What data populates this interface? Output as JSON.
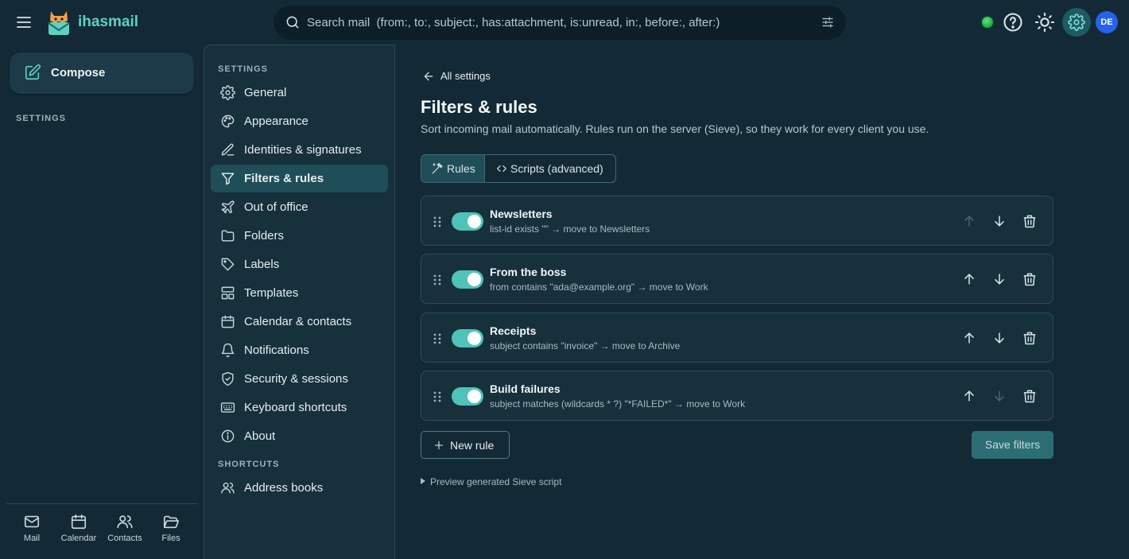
{
  "app": {
    "brand": "ihasmail",
    "search_placeholder": "Search mail  (from:, to:, subject:, has:attachment, is:unread, in:, before:, after:)",
    "avatar_initials": "DE",
    "accent_color": "#4fc3b8"
  },
  "rail": {
    "compose_label": "Compose",
    "section_heading": "SETTINGS",
    "bottom_nav": [
      {
        "label": "Mail",
        "icon": "mail-icon"
      },
      {
        "label": "Calendar",
        "icon": "calendar-icon"
      },
      {
        "label": "Contacts",
        "icon": "contacts-icon"
      },
      {
        "label": "Files",
        "icon": "folder-open-icon"
      }
    ]
  },
  "settings_nav": {
    "heading": "SETTINGS",
    "items": [
      {
        "label": "General",
        "icon": "gear-icon"
      },
      {
        "label": "Appearance",
        "icon": "palette-icon"
      },
      {
        "label": "Identities & signatures",
        "icon": "pen-icon"
      },
      {
        "label": "Filters & rules",
        "icon": "funnel-icon",
        "active": true
      },
      {
        "label": "Out of office",
        "icon": "plane-icon"
      },
      {
        "label": "Folders",
        "icon": "folder-icon"
      },
      {
        "label": "Labels",
        "icon": "tag-icon"
      },
      {
        "label": "Templates",
        "icon": "template-icon"
      },
      {
        "label": "Calendar & contacts",
        "icon": "calendar-icon"
      },
      {
        "label": "Notifications",
        "icon": "bell-icon"
      },
      {
        "label": "Security & sessions",
        "icon": "shield-icon"
      },
      {
        "label": "Keyboard shortcuts",
        "icon": "keyboard-icon"
      },
      {
        "label": "About",
        "icon": "info-icon"
      }
    ],
    "shortcuts_heading": "SHORTCUTS",
    "shortcuts": [
      {
        "label": "Address books",
        "icon": "contacts-icon"
      }
    ]
  },
  "main": {
    "back_label": "All settings",
    "title": "Filters & rules",
    "subtitle": "Sort incoming mail automatically. Rules run on the server (Sieve), so they work for every client you use.",
    "tabs": [
      {
        "label": "Rules",
        "icon": "magic-wand-icon",
        "active": true
      },
      {
        "label": "Scripts (advanced)",
        "icon": "code-icon",
        "active": false
      }
    ],
    "rules": [
      {
        "name": "Newsletters",
        "description": "list-id exists \"\" → move to Newsletters",
        "enabled": true,
        "can_move_up": false,
        "can_move_down": true
      },
      {
        "name": "From the boss",
        "description": "from contains \"ada@example.org\" → move to Work",
        "enabled": true,
        "can_move_up": true,
        "can_move_down": true
      },
      {
        "name": "Receipts",
        "description": "subject contains \"invoice\" → move to Archive",
        "enabled": true,
        "can_move_up": true,
        "can_move_down": true
      },
      {
        "name": "Build failures",
        "description": "subject matches (wildcards * ?) \"*FAILED*\" → move to Work",
        "enabled": true,
        "can_move_up": true,
        "can_move_down": false
      }
    ],
    "new_rule_label": "New rule",
    "save_label": "Save filters",
    "preview_label": "Preview generated Sieve script"
  }
}
